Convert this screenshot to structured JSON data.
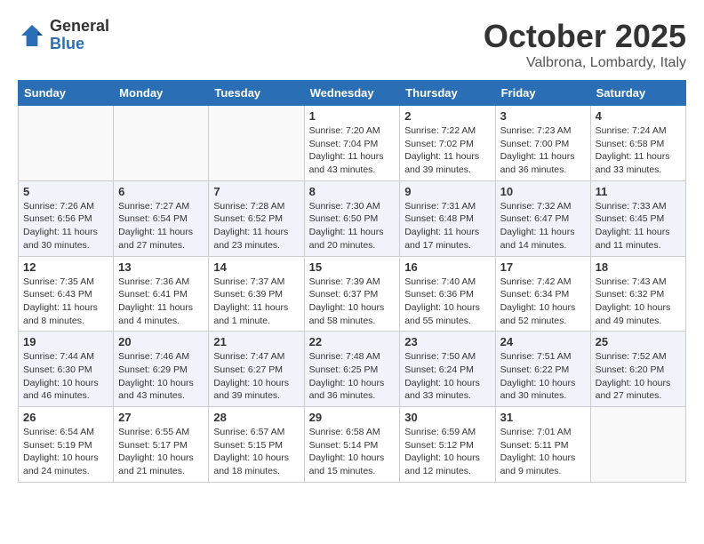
{
  "header": {
    "logo": {
      "general": "General",
      "blue": "Blue"
    },
    "title": "October 2025",
    "subtitle": "Valbrona, Lombardy, Italy"
  },
  "days_of_week": [
    "Sunday",
    "Monday",
    "Tuesday",
    "Wednesday",
    "Thursday",
    "Friday",
    "Saturday"
  ],
  "weeks": [
    [
      {
        "day": "",
        "info": ""
      },
      {
        "day": "",
        "info": ""
      },
      {
        "day": "",
        "info": ""
      },
      {
        "day": "1",
        "info": "Sunrise: 7:20 AM\nSunset: 7:04 PM\nDaylight: 11 hours and 43 minutes."
      },
      {
        "day": "2",
        "info": "Sunrise: 7:22 AM\nSunset: 7:02 PM\nDaylight: 11 hours and 39 minutes."
      },
      {
        "day": "3",
        "info": "Sunrise: 7:23 AM\nSunset: 7:00 PM\nDaylight: 11 hours and 36 minutes."
      },
      {
        "day": "4",
        "info": "Sunrise: 7:24 AM\nSunset: 6:58 PM\nDaylight: 11 hours and 33 minutes."
      }
    ],
    [
      {
        "day": "5",
        "info": "Sunrise: 7:26 AM\nSunset: 6:56 PM\nDaylight: 11 hours and 30 minutes."
      },
      {
        "day": "6",
        "info": "Sunrise: 7:27 AM\nSunset: 6:54 PM\nDaylight: 11 hours and 27 minutes."
      },
      {
        "day": "7",
        "info": "Sunrise: 7:28 AM\nSunset: 6:52 PM\nDaylight: 11 hours and 23 minutes."
      },
      {
        "day": "8",
        "info": "Sunrise: 7:30 AM\nSunset: 6:50 PM\nDaylight: 11 hours and 20 minutes."
      },
      {
        "day": "9",
        "info": "Sunrise: 7:31 AM\nSunset: 6:48 PM\nDaylight: 11 hours and 17 minutes."
      },
      {
        "day": "10",
        "info": "Sunrise: 7:32 AM\nSunset: 6:47 PM\nDaylight: 11 hours and 14 minutes."
      },
      {
        "day": "11",
        "info": "Sunrise: 7:33 AM\nSunset: 6:45 PM\nDaylight: 11 hours and 11 minutes."
      }
    ],
    [
      {
        "day": "12",
        "info": "Sunrise: 7:35 AM\nSunset: 6:43 PM\nDaylight: 11 hours and 8 minutes."
      },
      {
        "day": "13",
        "info": "Sunrise: 7:36 AM\nSunset: 6:41 PM\nDaylight: 11 hours and 4 minutes."
      },
      {
        "day": "14",
        "info": "Sunrise: 7:37 AM\nSunset: 6:39 PM\nDaylight: 11 hours and 1 minute."
      },
      {
        "day": "15",
        "info": "Sunrise: 7:39 AM\nSunset: 6:37 PM\nDaylight: 10 hours and 58 minutes."
      },
      {
        "day": "16",
        "info": "Sunrise: 7:40 AM\nSunset: 6:36 PM\nDaylight: 10 hours and 55 minutes."
      },
      {
        "day": "17",
        "info": "Sunrise: 7:42 AM\nSunset: 6:34 PM\nDaylight: 10 hours and 52 minutes."
      },
      {
        "day": "18",
        "info": "Sunrise: 7:43 AM\nSunset: 6:32 PM\nDaylight: 10 hours and 49 minutes."
      }
    ],
    [
      {
        "day": "19",
        "info": "Sunrise: 7:44 AM\nSunset: 6:30 PM\nDaylight: 10 hours and 46 minutes."
      },
      {
        "day": "20",
        "info": "Sunrise: 7:46 AM\nSunset: 6:29 PM\nDaylight: 10 hours and 43 minutes."
      },
      {
        "day": "21",
        "info": "Sunrise: 7:47 AM\nSunset: 6:27 PM\nDaylight: 10 hours and 39 minutes."
      },
      {
        "day": "22",
        "info": "Sunrise: 7:48 AM\nSunset: 6:25 PM\nDaylight: 10 hours and 36 minutes."
      },
      {
        "day": "23",
        "info": "Sunrise: 7:50 AM\nSunset: 6:24 PM\nDaylight: 10 hours and 33 minutes."
      },
      {
        "day": "24",
        "info": "Sunrise: 7:51 AM\nSunset: 6:22 PM\nDaylight: 10 hours and 30 minutes."
      },
      {
        "day": "25",
        "info": "Sunrise: 7:52 AM\nSunset: 6:20 PM\nDaylight: 10 hours and 27 minutes."
      }
    ],
    [
      {
        "day": "26",
        "info": "Sunrise: 6:54 AM\nSunset: 5:19 PM\nDaylight: 10 hours and 24 minutes."
      },
      {
        "day": "27",
        "info": "Sunrise: 6:55 AM\nSunset: 5:17 PM\nDaylight: 10 hours and 21 minutes."
      },
      {
        "day": "28",
        "info": "Sunrise: 6:57 AM\nSunset: 5:15 PM\nDaylight: 10 hours and 18 minutes."
      },
      {
        "day": "29",
        "info": "Sunrise: 6:58 AM\nSunset: 5:14 PM\nDaylight: 10 hours and 15 minutes."
      },
      {
        "day": "30",
        "info": "Sunrise: 6:59 AM\nSunset: 5:12 PM\nDaylight: 10 hours and 12 minutes."
      },
      {
        "day": "31",
        "info": "Sunrise: 7:01 AM\nSunset: 5:11 PM\nDaylight: 10 hours and 9 minutes."
      },
      {
        "day": "",
        "info": ""
      }
    ]
  ]
}
